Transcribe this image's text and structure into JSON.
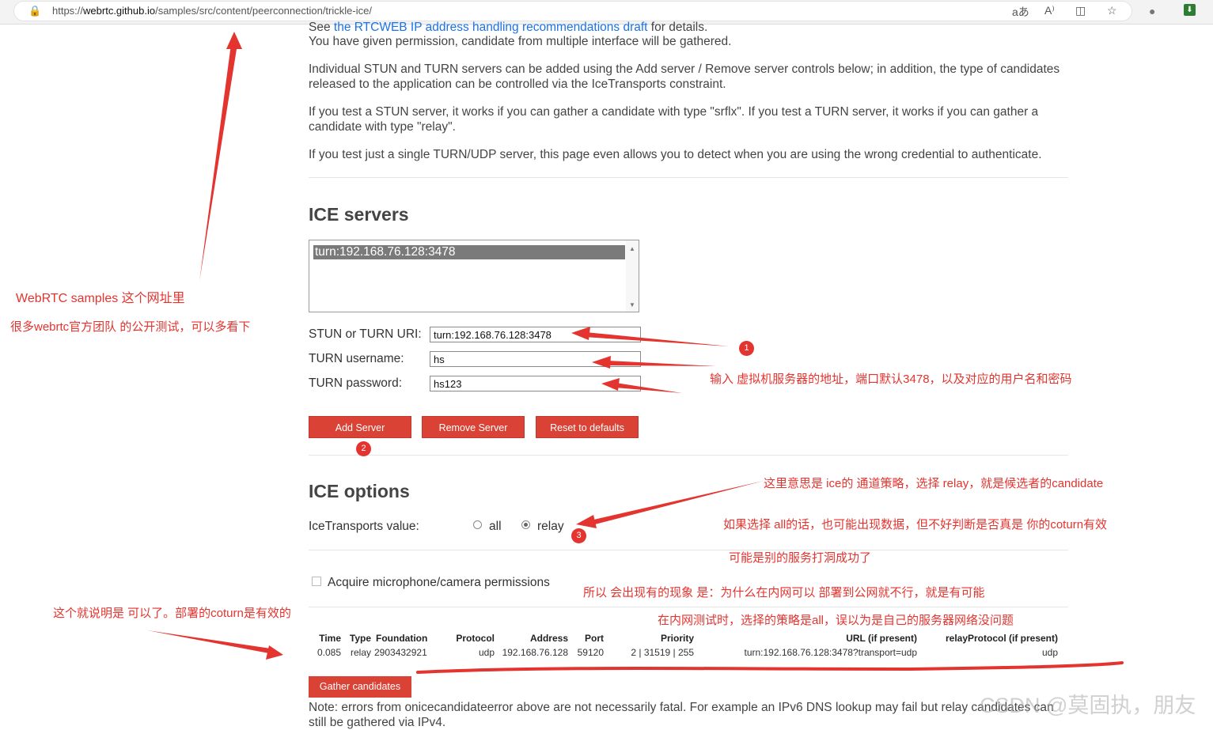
{
  "browser": {
    "url_prefix": "https://",
    "url_host": "webrtc.github.io",
    "url_path": "/samples/src/content/peerconnection/trickle-ice/",
    "icons": [
      "lock-icon",
      "translate-icon",
      "read-aloud-icon",
      "split-screen-icon",
      "favorite-star-icon",
      "extension-icon",
      "extension-green-icon"
    ]
  },
  "intro": {
    "see_prefix": "See ",
    "see_link": "the RTCWEB IP address handling recommendations draft",
    "see_suffix": " for details.",
    "permission": "You have given permission, candidate from multiple interface will be gathered.",
    "para1": "Individual STUN and TURN servers can be added using the Add server / Remove server controls below; in addition, the type of candidates released to the application can be controlled via the IceTransports constraint.",
    "para2": "If you test a STUN server, it works if you can gather a candidate with type \"srflx\". If you test a TURN server, it works if you can gather a candidate with type \"relay\".",
    "para3": "If you test just a single TURN/UDP server, this page even allows you to detect when you are using the wrong credential to authenticate."
  },
  "ice_servers": {
    "heading": "ICE servers",
    "list_item": "turn:192.168.76.128:3478",
    "uri_label": "STUN or TURN URI:",
    "uri_value": "turn:192.168.76.128:3478",
    "username_label": "TURN username:",
    "username_value": "hs",
    "password_label": "TURN password:",
    "password_value": "hs123",
    "add_button": "Add Server",
    "remove_button": "Remove Server",
    "reset_button": "Reset to defaults"
  },
  "ice_options": {
    "heading": "ICE options",
    "transports_label": "IceTransports value:",
    "option_all": "all",
    "option_relay": "relay",
    "selected": "relay",
    "acquire_label": "Acquire microphone/camera permissions"
  },
  "candidates": {
    "headers": [
      "Time",
      "Type",
      "Foundation",
      "Protocol",
      "Address",
      "Port",
      "Priority",
      "URL (if present)",
      "relayProtocol (if present)"
    ],
    "rows": [
      [
        "0.085",
        "relay",
        "2903432921",
        "udp",
        "192.168.76.128",
        "59120",
        "2 | 31519 | 255",
        "turn:192.168.76.128:3478?transport=udp",
        "udp"
      ]
    ]
  },
  "gather_button": "Gather candidates",
  "note": "Note: errors from onicecandidateerror above are not necessarily fatal. For example an IPv6 DNS lookup may fail but relay candidates can still be gathered via IPv4.",
  "annotations": {
    "left1": "WebRTC samples 这个网址里",
    "left2": "很多webrtc官方团队 的公开测试，可以多看下",
    "num1": "1",
    "num2": "2",
    "num3": "3",
    "input_note": "输入 虚拟机服务器的地址，端口默认3478，以及对应的用户名和密码",
    "ice_note1": "这里意思是 ice的 通道策略，选择 relay，就是候选者的candidate",
    "ice_note2": "如果选择 all的话，也可能出现数据，但不好判断是否真是 你的coturn有效",
    "ice_note3": "可能是别的服务打洞成功了",
    "ice_note4": "所以 会出现有的现象 是：为什么在内网可以 部署到公网就不行，就是有可能",
    "ice_note5": "在内网测试时，选择的策略是all，误以为是自己的服务器网络没问题",
    "result_note": "这个就说明是 可以了。部署的coturn是有效的",
    "accent_color": "#e3342f"
  },
  "watermark": "CSDN @莫固执，朋友"
}
